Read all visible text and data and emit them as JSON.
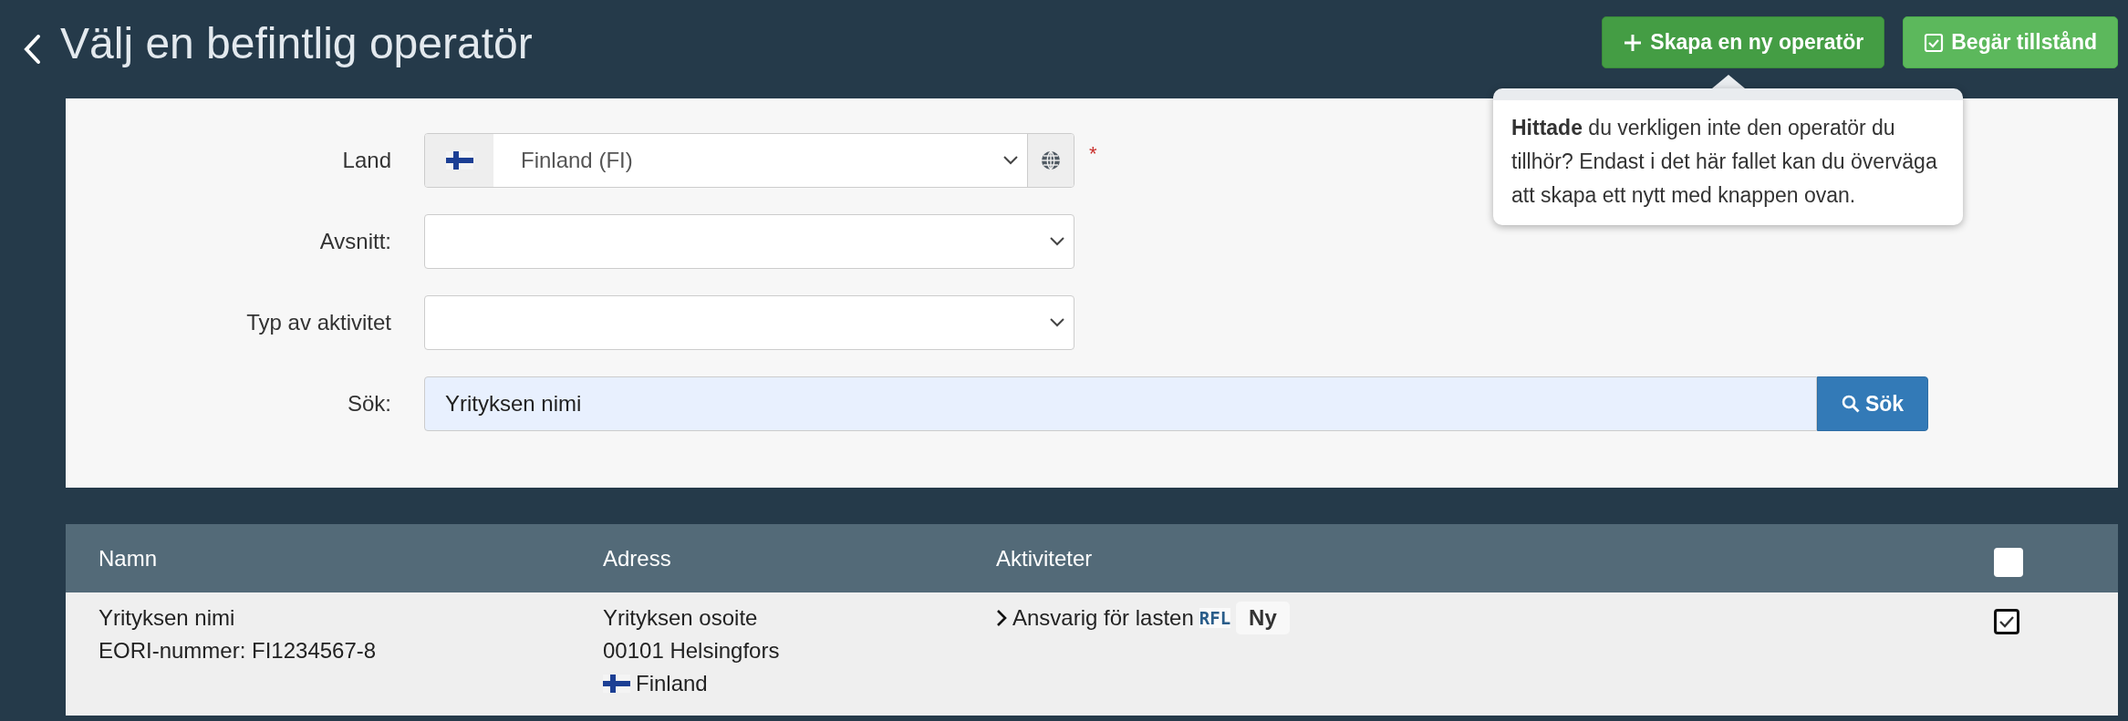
{
  "header": {
    "title": "Välj en befintlig operatör",
    "buttons": [
      {
        "label": "Skapa en ny operatör",
        "kind": "create"
      },
      {
        "label": "Begär tillstånd",
        "kind": "request"
      }
    ]
  },
  "tooltip": {
    "text": "**Hittade** du verkligen inte den operatör du tillhör? Endast i det här fallet kan du överväga att skapa ett nytt med knappen ovan."
  },
  "form": {
    "fields": [
      {
        "label": "Land",
        "kind": "country",
        "value": "Finland (FI)",
        "required_mark": "*"
      },
      {
        "label": "Avsnitt:",
        "kind": "select"
      },
      {
        "label": "Typ av aktivitet",
        "kind": "select"
      },
      {
        "label": "Sök:",
        "kind": "search",
        "value": "Yrityksen nimi",
        "button": "Sök"
      }
    ]
  },
  "table": {
    "columns": [
      "Namn",
      "Adress",
      "Aktiviteter"
    ],
    "select_all_checked": false,
    "rows": [
      {
        "name": "Yrityksen nimi",
        "eori": "EORI-nummer: FI1234567-8",
        "address": [
          "Yrityksen osoite",
          "00101 Helsingfors"
        ],
        "country": "Finland",
        "activity": "Ansvarig för lasten",
        "code": "RFL",
        "badge": "Ny",
        "checked": true
      }
    ]
  }
}
